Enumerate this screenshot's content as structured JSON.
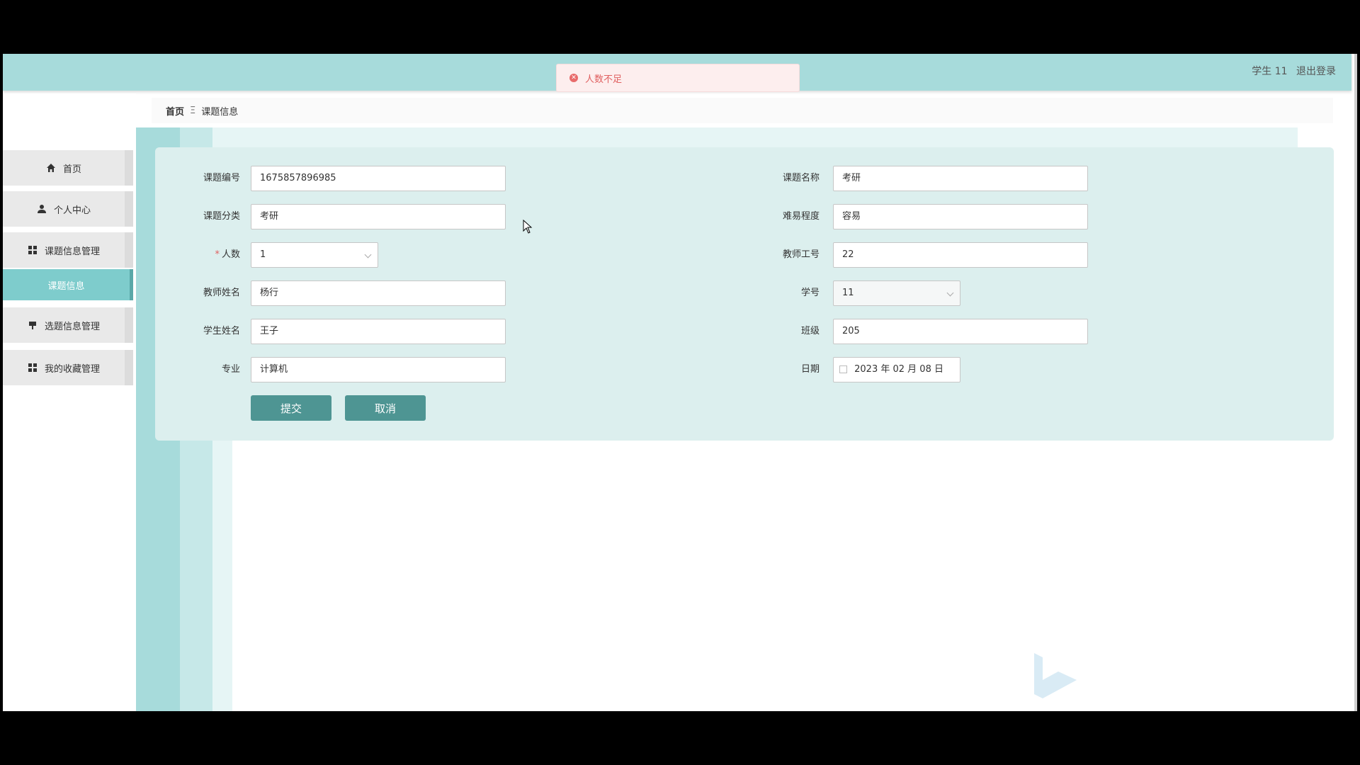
{
  "toast": {
    "message": "人数不足"
  },
  "header": {
    "user": "学生 11",
    "logout": "退出登录"
  },
  "sidebar": {
    "items": [
      {
        "label": "首页",
        "icon": "home-icon"
      },
      {
        "label": "个人中心",
        "icon": "user-icon"
      },
      {
        "label": "课题信息管理",
        "icon": "grid-icon"
      },
      {
        "label": "课题信息",
        "icon": ""
      },
      {
        "label": "选题信息管理",
        "icon": "flag-icon"
      },
      {
        "label": "我的收藏管理",
        "icon": "grid-icon"
      }
    ]
  },
  "breadcrumb": {
    "home": "首页",
    "separator": "Ξ",
    "current": "课题信息"
  },
  "form": {
    "topic_no": {
      "label": "课题编号",
      "value": "1675857896985"
    },
    "topic_name": {
      "label": "课题名称",
      "value": "考研"
    },
    "topic_category": {
      "label": "课题分类",
      "value": "考研"
    },
    "difficulty": {
      "label": "难易程度",
      "value": "容易"
    },
    "people": {
      "label": "人数",
      "required_mark": "*",
      "value": "1"
    },
    "teacher_no": {
      "label": "教师工号",
      "value": "22"
    },
    "teacher_name": {
      "label": "教师姓名",
      "value": "杨行"
    },
    "student_no": {
      "label": "学号",
      "value": "11"
    },
    "student_name": {
      "label": "学生姓名",
      "value": "王子"
    },
    "class": {
      "label": "班级",
      "value": "205"
    },
    "major": {
      "label": "专业",
      "value": "计算机"
    },
    "date": {
      "label": "日期",
      "value": "2023 年 02 月 08 日"
    },
    "submit": "提交",
    "cancel": "取消"
  },
  "colors": {
    "topbar": "#a7dbdb",
    "panel": "#dcefee",
    "button": "#4e9593",
    "active_nav": "#7ecccc"
  }
}
